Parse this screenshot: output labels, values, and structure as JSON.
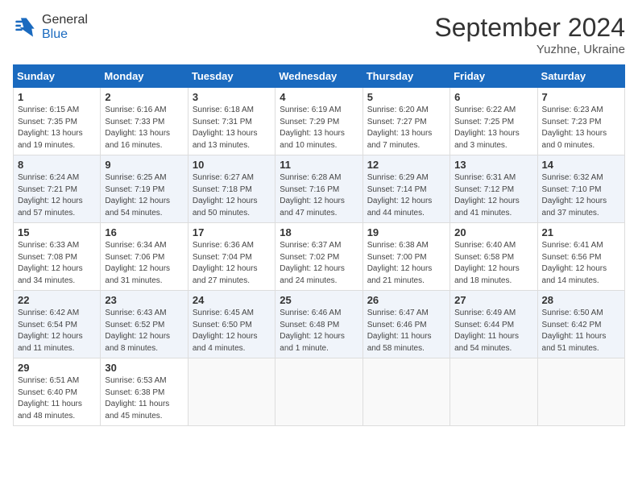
{
  "header": {
    "logo_general": "General",
    "logo_blue": "Blue",
    "month_title": "September 2024",
    "subtitle": "Yuzhne, Ukraine"
  },
  "days_of_week": [
    "Sunday",
    "Monday",
    "Tuesday",
    "Wednesday",
    "Thursday",
    "Friday",
    "Saturday"
  ],
  "weeks": [
    [
      {
        "num": "1",
        "sunrise": "6:15 AM",
        "sunset": "7:35 PM",
        "daylight": "13 hours and 19 minutes."
      },
      {
        "num": "2",
        "sunrise": "6:16 AM",
        "sunset": "7:33 PM",
        "daylight": "13 hours and 16 minutes."
      },
      {
        "num": "3",
        "sunrise": "6:18 AM",
        "sunset": "7:31 PM",
        "daylight": "13 hours and 13 minutes."
      },
      {
        "num": "4",
        "sunrise": "6:19 AM",
        "sunset": "7:29 PM",
        "daylight": "13 hours and 10 minutes."
      },
      {
        "num": "5",
        "sunrise": "6:20 AM",
        "sunset": "7:27 PM",
        "daylight": "13 hours and 7 minutes."
      },
      {
        "num": "6",
        "sunrise": "6:22 AM",
        "sunset": "7:25 PM",
        "daylight": "13 hours and 3 minutes."
      },
      {
        "num": "7",
        "sunrise": "6:23 AM",
        "sunset": "7:23 PM",
        "daylight": "13 hours and 0 minutes."
      }
    ],
    [
      {
        "num": "8",
        "sunrise": "6:24 AM",
        "sunset": "7:21 PM",
        "daylight": "12 hours and 57 minutes."
      },
      {
        "num": "9",
        "sunrise": "6:25 AM",
        "sunset": "7:19 PM",
        "daylight": "12 hours and 54 minutes."
      },
      {
        "num": "10",
        "sunrise": "6:27 AM",
        "sunset": "7:18 PM",
        "daylight": "12 hours and 50 minutes."
      },
      {
        "num": "11",
        "sunrise": "6:28 AM",
        "sunset": "7:16 PM",
        "daylight": "12 hours and 47 minutes."
      },
      {
        "num": "12",
        "sunrise": "6:29 AM",
        "sunset": "7:14 PM",
        "daylight": "12 hours and 44 minutes."
      },
      {
        "num": "13",
        "sunrise": "6:31 AM",
        "sunset": "7:12 PM",
        "daylight": "12 hours and 41 minutes."
      },
      {
        "num": "14",
        "sunrise": "6:32 AM",
        "sunset": "7:10 PM",
        "daylight": "12 hours and 37 minutes."
      }
    ],
    [
      {
        "num": "15",
        "sunrise": "6:33 AM",
        "sunset": "7:08 PM",
        "daylight": "12 hours and 34 minutes."
      },
      {
        "num": "16",
        "sunrise": "6:34 AM",
        "sunset": "7:06 PM",
        "daylight": "12 hours and 31 minutes."
      },
      {
        "num": "17",
        "sunrise": "6:36 AM",
        "sunset": "7:04 PM",
        "daylight": "12 hours and 27 minutes."
      },
      {
        "num": "18",
        "sunrise": "6:37 AM",
        "sunset": "7:02 PM",
        "daylight": "12 hours and 24 minutes."
      },
      {
        "num": "19",
        "sunrise": "6:38 AM",
        "sunset": "7:00 PM",
        "daylight": "12 hours and 21 minutes."
      },
      {
        "num": "20",
        "sunrise": "6:40 AM",
        "sunset": "6:58 PM",
        "daylight": "12 hours and 18 minutes."
      },
      {
        "num": "21",
        "sunrise": "6:41 AM",
        "sunset": "6:56 PM",
        "daylight": "12 hours and 14 minutes."
      }
    ],
    [
      {
        "num": "22",
        "sunrise": "6:42 AM",
        "sunset": "6:54 PM",
        "daylight": "12 hours and 11 minutes."
      },
      {
        "num": "23",
        "sunrise": "6:43 AM",
        "sunset": "6:52 PM",
        "daylight": "12 hours and 8 minutes."
      },
      {
        "num": "24",
        "sunrise": "6:45 AM",
        "sunset": "6:50 PM",
        "daylight": "12 hours and 4 minutes."
      },
      {
        "num": "25",
        "sunrise": "6:46 AM",
        "sunset": "6:48 PM",
        "daylight": "12 hours and 1 minute."
      },
      {
        "num": "26",
        "sunrise": "6:47 AM",
        "sunset": "6:46 PM",
        "daylight": "11 hours and 58 minutes."
      },
      {
        "num": "27",
        "sunrise": "6:49 AM",
        "sunset": "6:44 PM",
        "daylight": "11 hours and 54 minutes."
      },
      {
        "num": "28",
        "sunrise": "6:50 AM",
        "sunset": "6:42 PM",
        "daylight": "11 hours and 51 minutes."
      }
    ],
    [
      {
        "num": "29",
        "sunrise": "6:51 AM",
        "sunset": "6:40 PM",
        "daylight": "11 hours and 48 minutes."
      },
      {
        "num": "30",
        "sunrise": "6:53 AM",
        "sunset": "6:38 PM",
        "daylight": "11 hours and 45 minutes."
      },
      null,
      null,
      null,
      null,
      null
    ]
  ]
}
